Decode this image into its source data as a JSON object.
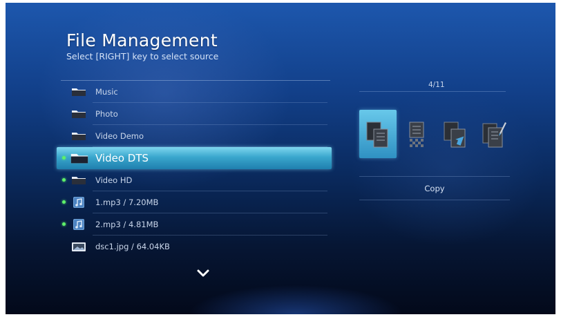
{
  "header": {
    "title": "File Management",
    "subtitle": "Select [RIGHT] key to select source"
  },
  "list": {
    "items": [
      {
        "label": "Music",
        "icon": "folder-icon",
        "marked": false,
        "selected": false
      },
      {
        "label": "Photo",
        "icon": "folder-icon",
        "marked": false,
        "selected": false
      },
      {
        "label": "Video Demo",
        "icon": "folder-icon",
        "marked": false,
        "selected": false
      },
      {
        "label": "Video DTS",
        "icon": "folder-icon",
        "marked": true,
        "selected": true
      },
      {
        "label": "Video HD",
        "icon": "folder-icon",
        "marked": true,
        "selected": false
      },
      {
        "label": "1.mp3 / 7.20MB",
        "icon": "music-file-icon",
        "marked": true,
        "selected": false
      },
      {
        "label": "2.mp3 / 4.81MB",
        "icon": "music-file-icon",
        "marked": true,
        "selected": false
      },
      {
        "label": "dsc1.jpg / 64.04KB",
        "icon": "image-file-icon",
        "marked": false,
        "selected": false
      }
    ],
    "more_icon": "chevron-down-icon"
  },
  "right_panel": {
    "page_counter": "4/11",
    "actions": [
      {
        "name": "copy-icon",
        "selected": true
      },
      {
        "name": "delete-icon",
        "selected": false
      },
      {
        "name": "move-icon",
        "selected": false
      },
      {
        "name": "rename-icon",
        "selected": false
      }
    ],
    "selected_action_label": "Copy"
  },
  "colors": {
    "accent": "#3aa7cd",
    "marker": "#5ef06a",
    "background_top": "#1d57ad",
    "background_bottom": "#03091a"
  }
}
